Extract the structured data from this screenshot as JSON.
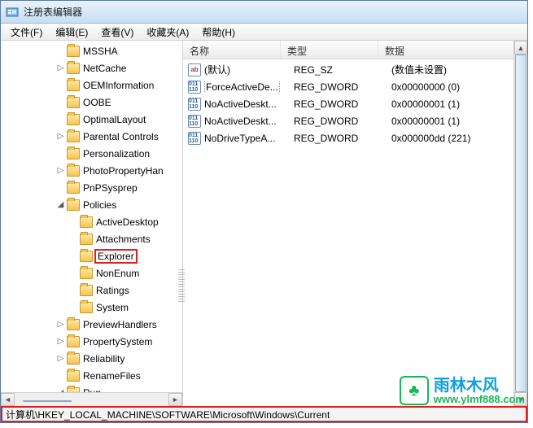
{
  "window": {
    "title": "注册表编辑器"
  },
  "menu": {
    "file": "文件(F)",
    "edit": "编辑(E)",
    "view": "查看(V)",
    "favorites": "收藏夹(A)",
    "help": "帮助(H)"
  },
  "tree": [
    {
      "indent": 3,
      "exp": "",
      "label": "MSSHA"
    },
    {
      "indent": 3,
      "exp": "▷",
      "label": "NetCache"
    },
    {
      "indent": 3,
      "exp": "",
      "label": "OEMInformation"
    },
    {
      "indent": 3,
      "exp": "",
      "label": "OOBE"
    },
    {
      "indent": 3,
      "exp": "",
      "label": "OptimalLayout"
    },
    {
      "indent": 3,
      "exp": "▷",
      "label": "Parental Controls"
    },
    {
      "indent": 3,
      "exp": "",
      "label": "Personalization"
    },
    {
      "indent": 3,
      "exp": "▷",
      "label": "PhotoPropertyHan"
    },
    {
      "indent": 3,
      "exp": "",
      "label": "PnPSysprep"
    },
    {
      "indent": 3,
      "exp": "◢",
      "label": "Policies"
    },
    {
      "indent": 4,
      "exp": "",
      "label": "ActiveDesktop"
    },
    {
      "indent": 4,
      "exp": "",
      "label": "Attachments"
    },
    {
      "indent": 4,
      "exp": "",
      "label": "Explorer",
      "highlight": true
    },
    {
      "indent": 4,
      "exp": "",
      "label": "NonEnum"
    },
    {
      "indent": 4,
      "exp": "",
      "label": "Ratings"
    },
    {
      "indent": 4,
      "exp": "",
      "label": "System"
    },
    {
      "indent": 3,
      "exp": "▷",
      "label": "PreviewHandlers"
    },
    {
      "indent": 3,
      "exp": "▷",
      "label": "PropertySystem"
    },
    {
      "indent": 3,
      "exp": "▷",
      "label": "Reliability"
    },
    {
      "indent": 3,
      "exp": "",
      "label": "RenameFiles"
    },
    {
      "indent": 3,
      "exp": "◢",
      "label": "Run"
    }
  ],
  "columns": {
    "name": "名称",
    "type": "类型",
    "data": "数据"
  },
  "values": [
    {
      "icon": "str",
      "name": "(默认)",
      "type": "REG_SZ",
      "data": "(数值未设置)"
    },
    {
      "icon": "bin",
      "name": "ForceActiveDe...",
      "type": "REG_DWORD",
      "data": "0x00000000 (0)",
      "focus": true
    },
    {
      "icon": "bin",
      "name": "NoActiveDeskt...",
      "type": "REG_DWORD",
      "data": "0x00000001 (1)"
    },
    {
      "icon": "bin",
      "name": "NoActiveDeskt...",
      "type": "REG_DWORD",
      "data": "0x00000001 (1)"
    },
    {
      "icon": "bin",
      "name": "NoDriveTypeA...",
      "type": "REG_DWORD",
      "data": "0x000000dd (221)"
    }
  ],
  "status": {
    "path": "计算机\\HKEY_LOCAL_MACHINE\\SOFTWARE\\Microsoft\\Windows\\Current"
  },
  "watermark": {
    "brand": "雨林木风",
    "url": "www.ylmf888.com"
  }
}
